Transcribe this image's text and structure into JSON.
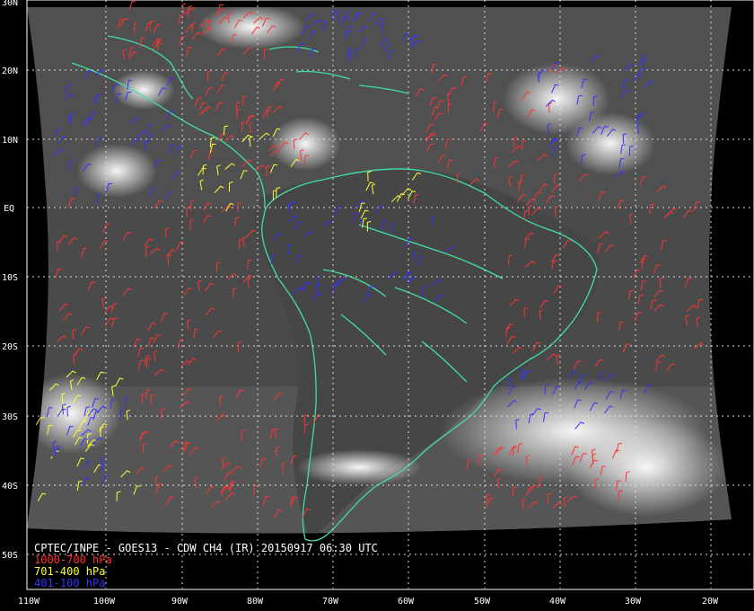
{
  "header": {
    "title": "CPTEC/INPE - GOES13 - CDW CH4 (IR) 20150917 06:30 UTC"
  },
  "legend": [
    {
      "label": "1000-700 hPa",
      "color": "#ff3333"
    },
    {
      "label": "701-400 hPa",
      "color": "#ffff33"
    },
    {
      "label": "401-100 hPa",
      "color": "#3333ff"
    }
  ],
  "grid": {
    "lat_labels": [
      "30N",
      "20N",
      "10N",
      "EQ",
      "10S",
      "20S",
      "30S",
      "40S",
      "50S"
    ],
    "lon_labels": [
      "110W",
      "100W",
      "90W",
      "80W",
      "70W",
      "60W",
      "50W",
      "40W",
      "30W",
      "20W"
    ]
  },
  "colors": {
    "coastline": "#40e0a0",
    "grid": "#dddddd",
    "space": "#000000",
    "land": "#4a4a4a",
    "cloud": "#f0f0f0"
  }
}
